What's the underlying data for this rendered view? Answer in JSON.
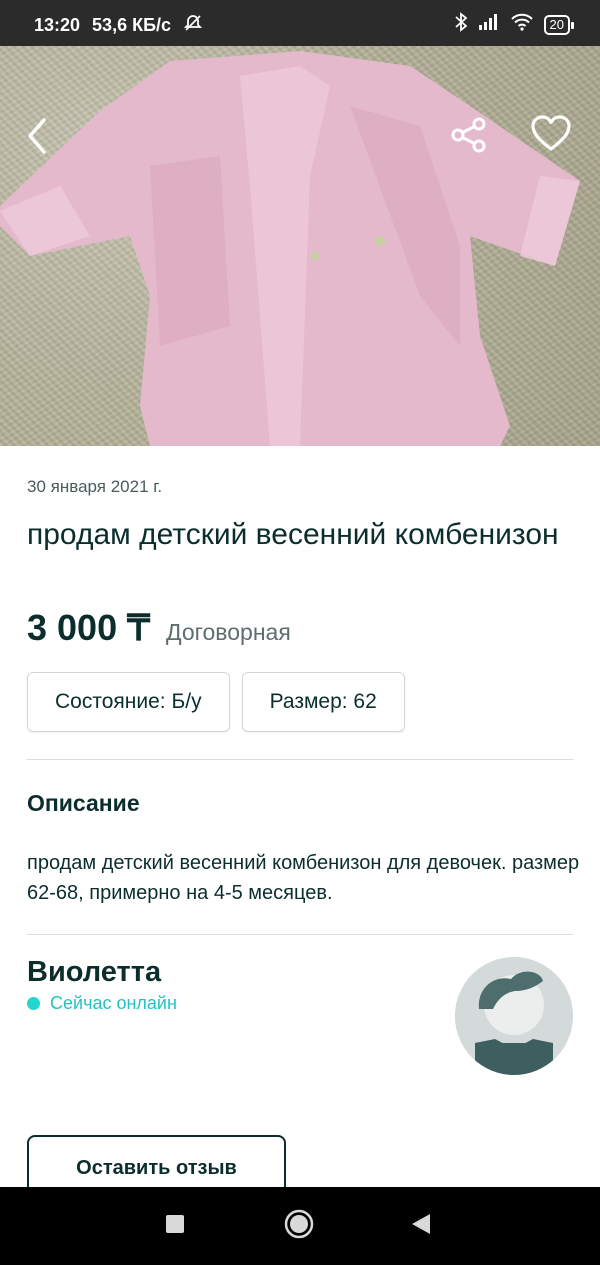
{
  "status_bar": {
    "time": "13:20",
    "speed": "53,6 КБ/с",
    "battery": "20"
  },
  "photo": {
    "icons": [
      "back-arrow-icon",
      "share-icon",
      "heart-icon"
    ]
  },
  "listing": {
    "date": "30 января 2021 г.",
    "title": "продам детский весенний комбенизон",
    "price": "3 000 ₸",
    "negotiable": "Договорная",
    "chips": [
      "Состояние: Б/у",
      "Размер: 62"
    ]
  },
  "description": {
    "heading": "Описание",
    "text": "продам детский весенний комбенизон для девочек. размер 62-68, примерно на 4-5 месяцев."
  },
  "seller": {
    "name": "Виолетта",
    "status": "Сейчас онлайн"
  },
  "actions": {
    "review_label": "Оставить отзыв"
  },
  "colors": {
    "accent_dark": "#0b2e2d",
    "online": "#23d6cd"
  }
}
